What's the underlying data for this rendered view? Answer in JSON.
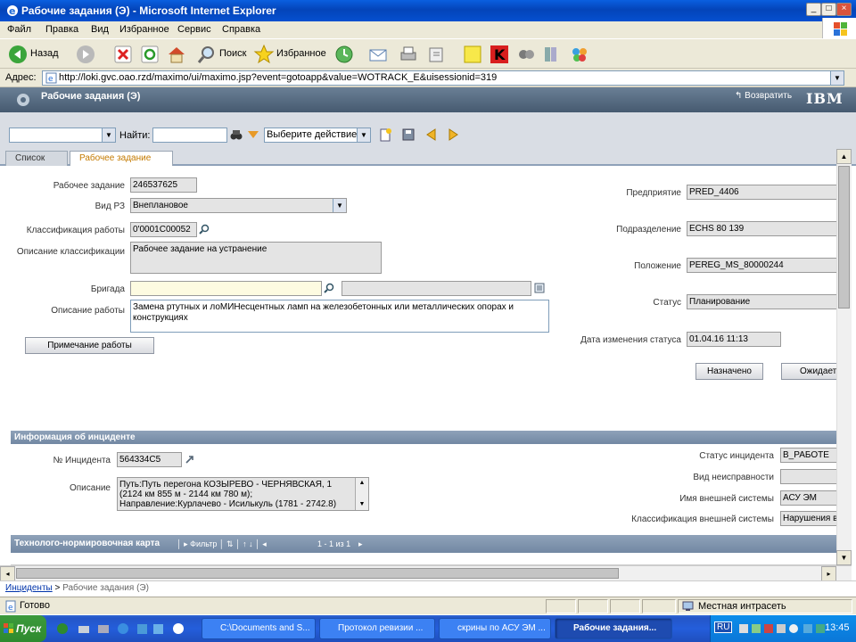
{
  "window": {
    "title": "Рабочие задания (Э) - Microsoft Internet Explorer"
  },
  "menu": [
    "Файл",
    "Правка",
    "Вид",
    "Избранное",
    "Сервис",
    "Справка"
  ],
  "ie_toolbar": {
    "back": "Назад",
    "search": "Поиск",
    "favorites": "Избранное"
  },
  "address": {
    "label": "Адрес:",
    "url": "http://loki.gvc.oao.rzd/maximo/ui/maximo.jsp?event=gotoapp&value=WOTRACK_E&uisessionid=319"
  },
  "app": {
    "title": "Рабочие задания (Э)",
    "return_label": "Возвратить",
    "brand": "IBM"
  },
  "mx_toolbar": {
    "find_label": "Найти:",
    "action_select": "Выберите действие"
  },
  "tabs": [
    {
      "label": "Список",
      "active": false
    },
    {
      "label": "Рабочее задание",
      "active": true
    }
  ],
  "form": {
    "wo_label": "Рабочее задание",
    "wo_value": "246537625",
    "type_label": "Вид РЗ",
    "type_value": "Внеплановое",
    "class_label": "Классификация работы",
    "class_value": "0'0001C00052",
    "class_desc_label": "Описание классификации",
    "class_desc_value": "Рабочее задание на устранение",
    "crew_label": "Бригада",
    "desc_label": "Описание работы",
    "desc_value": "Замена ртутных и лоМИНесцентных ламп на железобетонных или металлических опорах и конструкциях",
    "note_button": "Примечание работы",
    "org_label": "Предприятие",
    "org_value": "PRED_4406",
    "dept_label": "Подразделение",
    "dept_value": "ECHS 80 139",
    "loc_label": "Положение",
    "loc_value": "PEREG_MS_80000244",
    "status_label": "Статус",
    "status_value": "Планирование",
    "status_date_label": "Дата изменения статуса",
    "status_date_value": "01.04.16 11:13",
    "btn_assigned": "Назначено",
    "btn_waiting": "Ожидает"
  },
  "incident": {
    "section_title": "Информация об инциденте",
    "num_label": "№ Инцидента",
    "num_value": "564334C5",
    "desc_label": "Описание",
    "desc_lines": [
      "Путь:Путь перегона КОЗЫРЕВО - ЧЕРНЯВСКАЯ, 1",
      "(2124 км 855 м - 2144 км 780 м);",
      "Направление:Курлачево - Исилькуль (1781 - 2742.8)"
    ],
    "status_label": "Статус инцидента",
    "status_value": "В_РАБОТЕ",
    "fault_label": "Вид неисправности",
    "fault_value": "",
    "ext_label": "Имя внешней системы",
    "ext_value": "АСУ ЭМ",
    "ext_class_label": "Классификация внешней системы",
    "ext_class_value": "Нарушения в"
  },
  "tech_card": {
    "title": "Технолого-нормировочная карта",
    "filter": "Фильтр",
    "pager": "1 - 1 из 1"
  },
  "breadcrumb": {
    "link": "Инциденты",
    "sep": " > ",
    "current": "Рабочие задания (Э)"
  },
  "statusbar": {
    "left": "Готово",
    "zone": "Местная интрасеть"
  },
  "taskbar": {
    "start": "Пуск",
    "tasks": [
      "C:\\Documents and S...",
      "Протокол ревизии ...",
      "скрины по АСУ ЭМ ...",
      "Рабочие задания..."
    ],
    "lang": "RU",
    "clock": "13:45"
  }
}
